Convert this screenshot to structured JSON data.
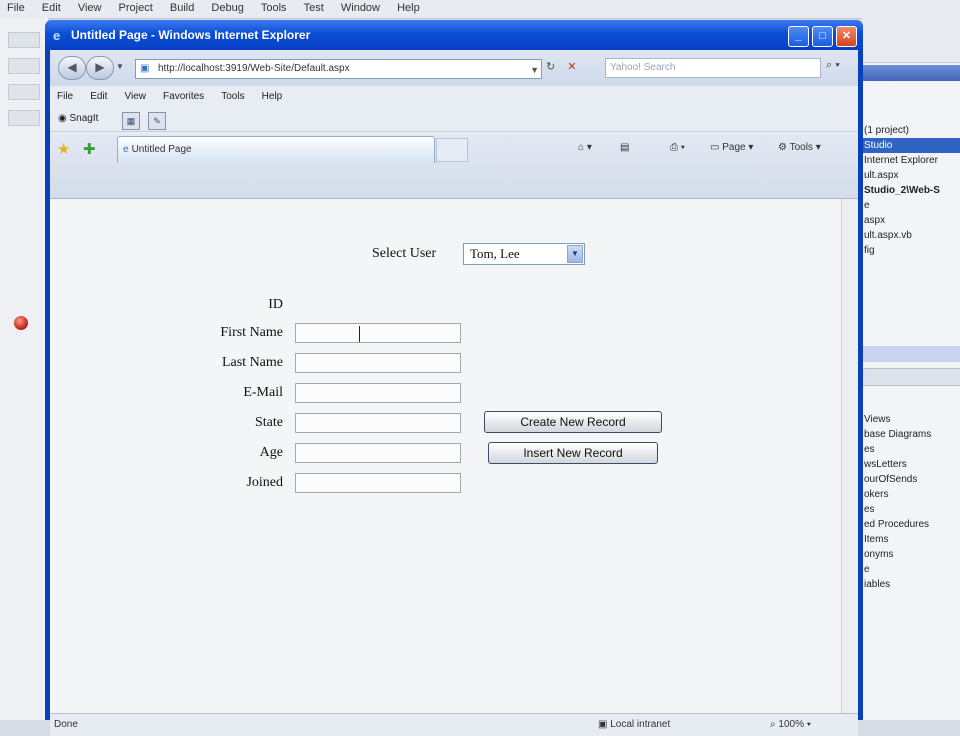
{
  "ide": {
    "menu": [
      "File",
      "Edit",
      "View",
      "Project",
      "Build",
      "Debug",
      "Tools",
      "Test",
      "Window",
      "Help"
    ],
    "solution_items": [
      {
        "label": "(1 project)",
        "selected": false
      },
      {
        "label": "Studio",
        "selected": true
      },
      {
        "label": "Internet Explorer",
        "selected": false
      },
      {
        "label": "ult.aspx",
        "selected": false
      },
      {
        "label": "Studio_2\\Web-S",
        "selected": false
      },
      {
        "label": "e",
        "selected": false
      },
      {
        "label": "aspx",
        "selected": false
      },
      {
        "label": "ult.aspx.vb",
        "selected": false
      },
      {
        "label": "fig",
        "selected": false
      }
    ],
    "server_items": [
      "Views",
      "base Diagrams",
      "es",
      "wsLetters",
      "ourOfSends",
      "okers",
      "es",
      "ed Procedures",
      "Items",
      "onyms",
      "e",
      "iables"
    ]
  },
  "browser": {
    "title": "Untitled Page - Windows Internet Explorer",
    "window_buttons": {
      "minimize": "_",
      "maximize": "□",
      "close": "✕"
    },
    "address": "http://localhost:3919/Web-Site/Default.aspx",
    "search_placeholder": "Yahoo! Search",
    "menu": [
      "File",
      "Edit",
      "View",
      "Favorites",
      "Tools",
      "Help"
    ],
    "links": {
      "snagit": "SnagIt"
    },
    "tab_label": "Untitled Page",
    "commands": {
      "page": "Page",
      "tools": "Tools"
    },
    "status": {
      "left": "Done",
      "zone": "Local intranet",
      "zoom": "100%"
    }
  },
  "form": {
    "select_label": "Select User",
    "select_value": "Tom, Lee",
    "fields": [
      {
        "label": "ID",
        "value": "",
        "has_input": false
      },
      {
        "label": "First Name",
        "value": "",
        "has_input": true
      },
      {
        "label": "Last Name",
        "value": "",
        "has_input": true
      },
      {
        "label": "E-Mail",
        "value": "",
        "has_input": true
      },
      {
        "label": "State",
        "value": "",
        "has_input": true
      },
      {
        "label": "Age",
        "value": "",
        "has_input": true
      },
      {
        "label": "Joined",
        "value": "",
        "has_input": true
      }
    ],
    "buttons": {
      "create": "Create New Record",
      "insert": "Insert New Record"
    }
  }
}
